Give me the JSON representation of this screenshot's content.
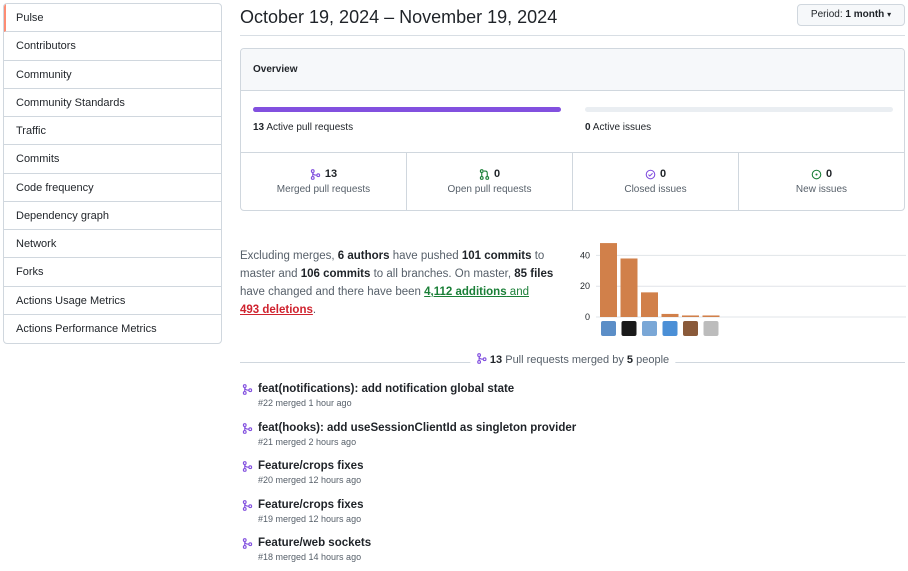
{
  "sidebar": {
    "items": [
      {
        "label": "Pulse"
      },
      {
        "label": "Contributors"
      },
      {
        "label": "Community"
      },
      {
        "label": "Community Standards"
      },
      {
        "label": "Traffic"
      },
      {
        "label": "Commits"
      },
      {
        "label": "Code frequency"
      },
      {
        "label": "Dependency graph"
      },
      {
        "label": "Network"
      },
      {
        "label": "Forks"
      },
      {
        "label": "Actions Usage Metrics"
      },
      {
        "label": "Actions Performance Metrics"
      }
    ]
  },
  "header": {
    "date_range": "October 19, 2024 – November 19, 2024",
    "period_label": "Period:",
    "period_value": "1 month"
  },
  "overview": {
    "title": "Overview",
    "active_prs_count": "13",
    "active_prs_label": "Active pull requests",
    "active_prs_fraction": 1.0,
    "active_issues_count": "0",
    "active_issues_label": "Active issues",
    "active_issues_fraction": 0.0,
    "stats": {
      "merged": {
        "count": "13",
        "label": "Merged pull requests"
      },
      "open": {
        "count": "0",
        "label": "Open pull requests"
      },
      "closed": {
        "count": "0",
        "label": "Closed issues"
      },
      "new": {
        "count": "0",
        "label": "New issues"
      }
    }
  },
  "summary": {
    "p1": "Excluding merges, ",
    "authors": "6 authors",
    "p2": " have pushed ",
    "commits": "101 commits",
    "p3": " to master and ",
    "all_commits": "106 commits",
    "p4": " to all branches. On master, ",
    "files": "85 files",
    "p5": " have changed and there have been ",
    "additions": "4,112 additions",
    "p6": " and ",
    "deletions": "493 deletions",
    "p7": "."
  },
  "chart_data": {
    "type": "bar",
    "categories": [
      "author1",
      "author2",
      "author3",
      "author4",
      "author5",
      "author6"
    ],
    "values": [
      48,
      38,
      16,
      2,
      1,
      1
    ],
    "ylim": [
      0,
      50
    ],
    "yticks": [
      "0",
      "20",
      "40"
    ],
    "bar_color": "#d1804a"
  },
  "merged_header": {
    "count": "13",
    "text": "Pull requests merged by",
    "people_count": "5",
    "people_label": "people"
  },
  "prs": [
    {
      "title": "feat(notifications): add notification global state",
      "meta": "#22 merged 1 hour ago"
    },
    {
      "title": "feat(hooks): add useSessionClientId as singleton provider",
      "meta": "#21 merged 2 hours ago"
    },
    {
      "title": "Feature/crops fixes",
      "meta": "#20 merged 12 hours ago"
    },
    {
      "title": "Feature/crops fixes",
      "meta": "#19 merged 12 hours ago"
    },
    {
      "title": "Feature/web sockets",
      "meta": "#18 merged 14 hours ago"
    }
  ]
}
